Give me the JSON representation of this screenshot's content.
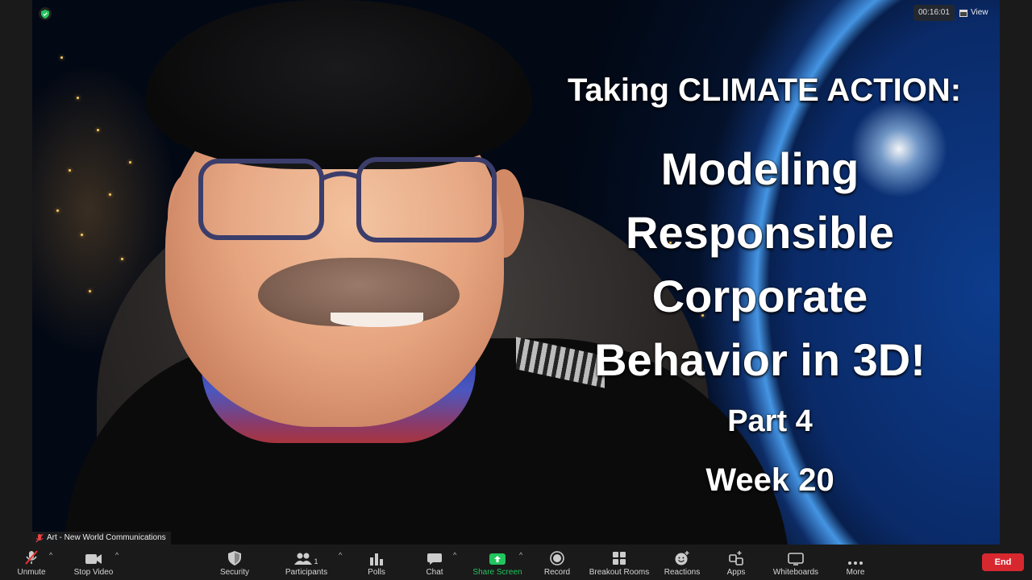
{
  "overlay": {
    "timer": "00:16:01",
    "view_label": "View",
    "participant_name": "Art - New World Communications"
  },
  "slide": {
    "subtitle": "Taking CLIMATE ACTION:",
    "title_lines": [
      "Modeling",
      "Responsible",
      "Corporate",
      "Behavior in 3D!"
    ],
    "part": "Part 4",
    "week": "Week 20"
  },
  "toolbar": {
    "unmute": "Unmute",
    "stop_video": "Stop Video",
    "security": "Security",
    "participants": "Participants",
    "participants_count": "1",
    "polls": "Polls",
    "chat": "Chat",
    "share_screen": "Share Screen",
    "record": "Record",
    "breakout_rooms": "Breakout Rooms",
    "reactions": "Reactions",
    "apps": "Apps",
    "whiteboards": "Whiteboards",
    "more": "More",
    "end": "End"
  },
  "colors": {
    "share_green": "#22c55e",
    "end_red": "#d8282f",
    "toolbar_bg": "#1a1a1a"
  }
}
